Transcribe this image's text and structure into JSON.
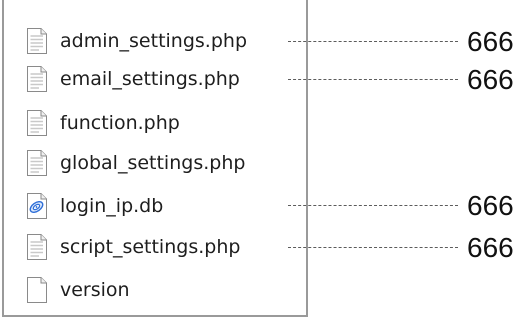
{
  "files": [
    {
      "name": "admin_settings.php",
      "icon": "document-icon",
      "permission": "666"
    },
    {
      "name": "email_settings.php",
      "icon": "document-icon",
      "permission": "666"
    },
    {
      "name": "function.php",
      "icon": "document-icon",
      "permission": ""
    },
    {
      "name": "global_settings.php",
      "icon": "document-icon",
      "permission": ""
    },
    {
      "name": "login_ip.db",
      "icon": "database-file-icon",
      "permission": "666"
    },
    {
      "name": "script_settings.php",
      "icon": "document-icon",
      "permission": "666"
    },
    {
      "name": "version",
      "icon": "blank-file-icon",
      "permission": ""
    }
  ],
  "colors": {
    "panel_border": "#9a9a9a",
    "leader_line": "#5c5c5c",
    "text": "#1e1e1e",
    "db_icon_accent": "#2f6fd8"
  }
}
